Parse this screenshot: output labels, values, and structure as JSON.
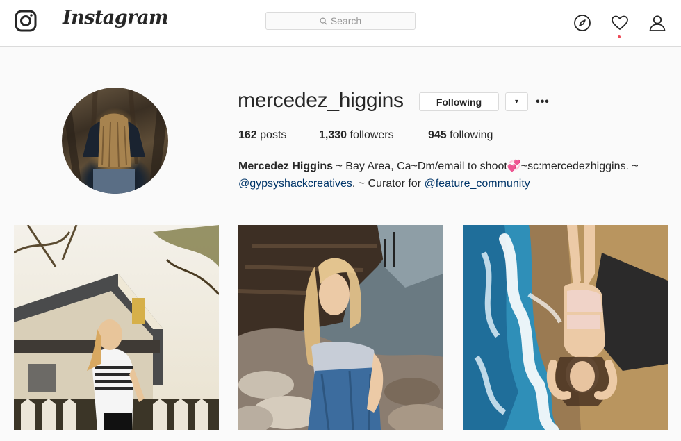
{
  "nav": {
    "brand": "Instagram",
    "search_placeholder": "Search",
    "icons": [
      "instagram-glyph-icon",
      "search-icon",
      "explore-compass-icon",
      "heart-icon",
      "profile-icon"
    ],
    "notification_dot_color": "#ed4956"
  },
  "profile": {
    "username": "mercedez_higgins",
    "following_button": "Following",
    "dropdown_icon": "▾",
    "more_icon": "•••",
    "stats": {
      "posts_count": "162",
      "posts_label": "posts",
      "followers_count": "1,330",
      "followers_label": "followers",
      "following_count": "945",
      "following_label": "following"
    },
    "bio": {
      "full_name": "Mercedez Higgins",
      "text_1": " ~ Bay Area, Ca~Dm/email to shoot💞~sc:mercedezhiggins. ~ ",
      "mention_1": "@gypsyshackcreatives",
      "text_2": ". ~ Curator for ",
      "mention_2": "@feature_community"
    }
  },
  "posts": [
    {
      "label": "post-house-girl-striped-shirt"
    },
    {
      "label": "post-girl-rocks-ocean"
    },
    {
      "label": "post-girl-beach-waves"
    }
  ],
  "colors": {
    "link": "#003569",
    "border": "#dbdbdb",
    "background": "#fafafa",
    "text": "#262626"
  }
}
